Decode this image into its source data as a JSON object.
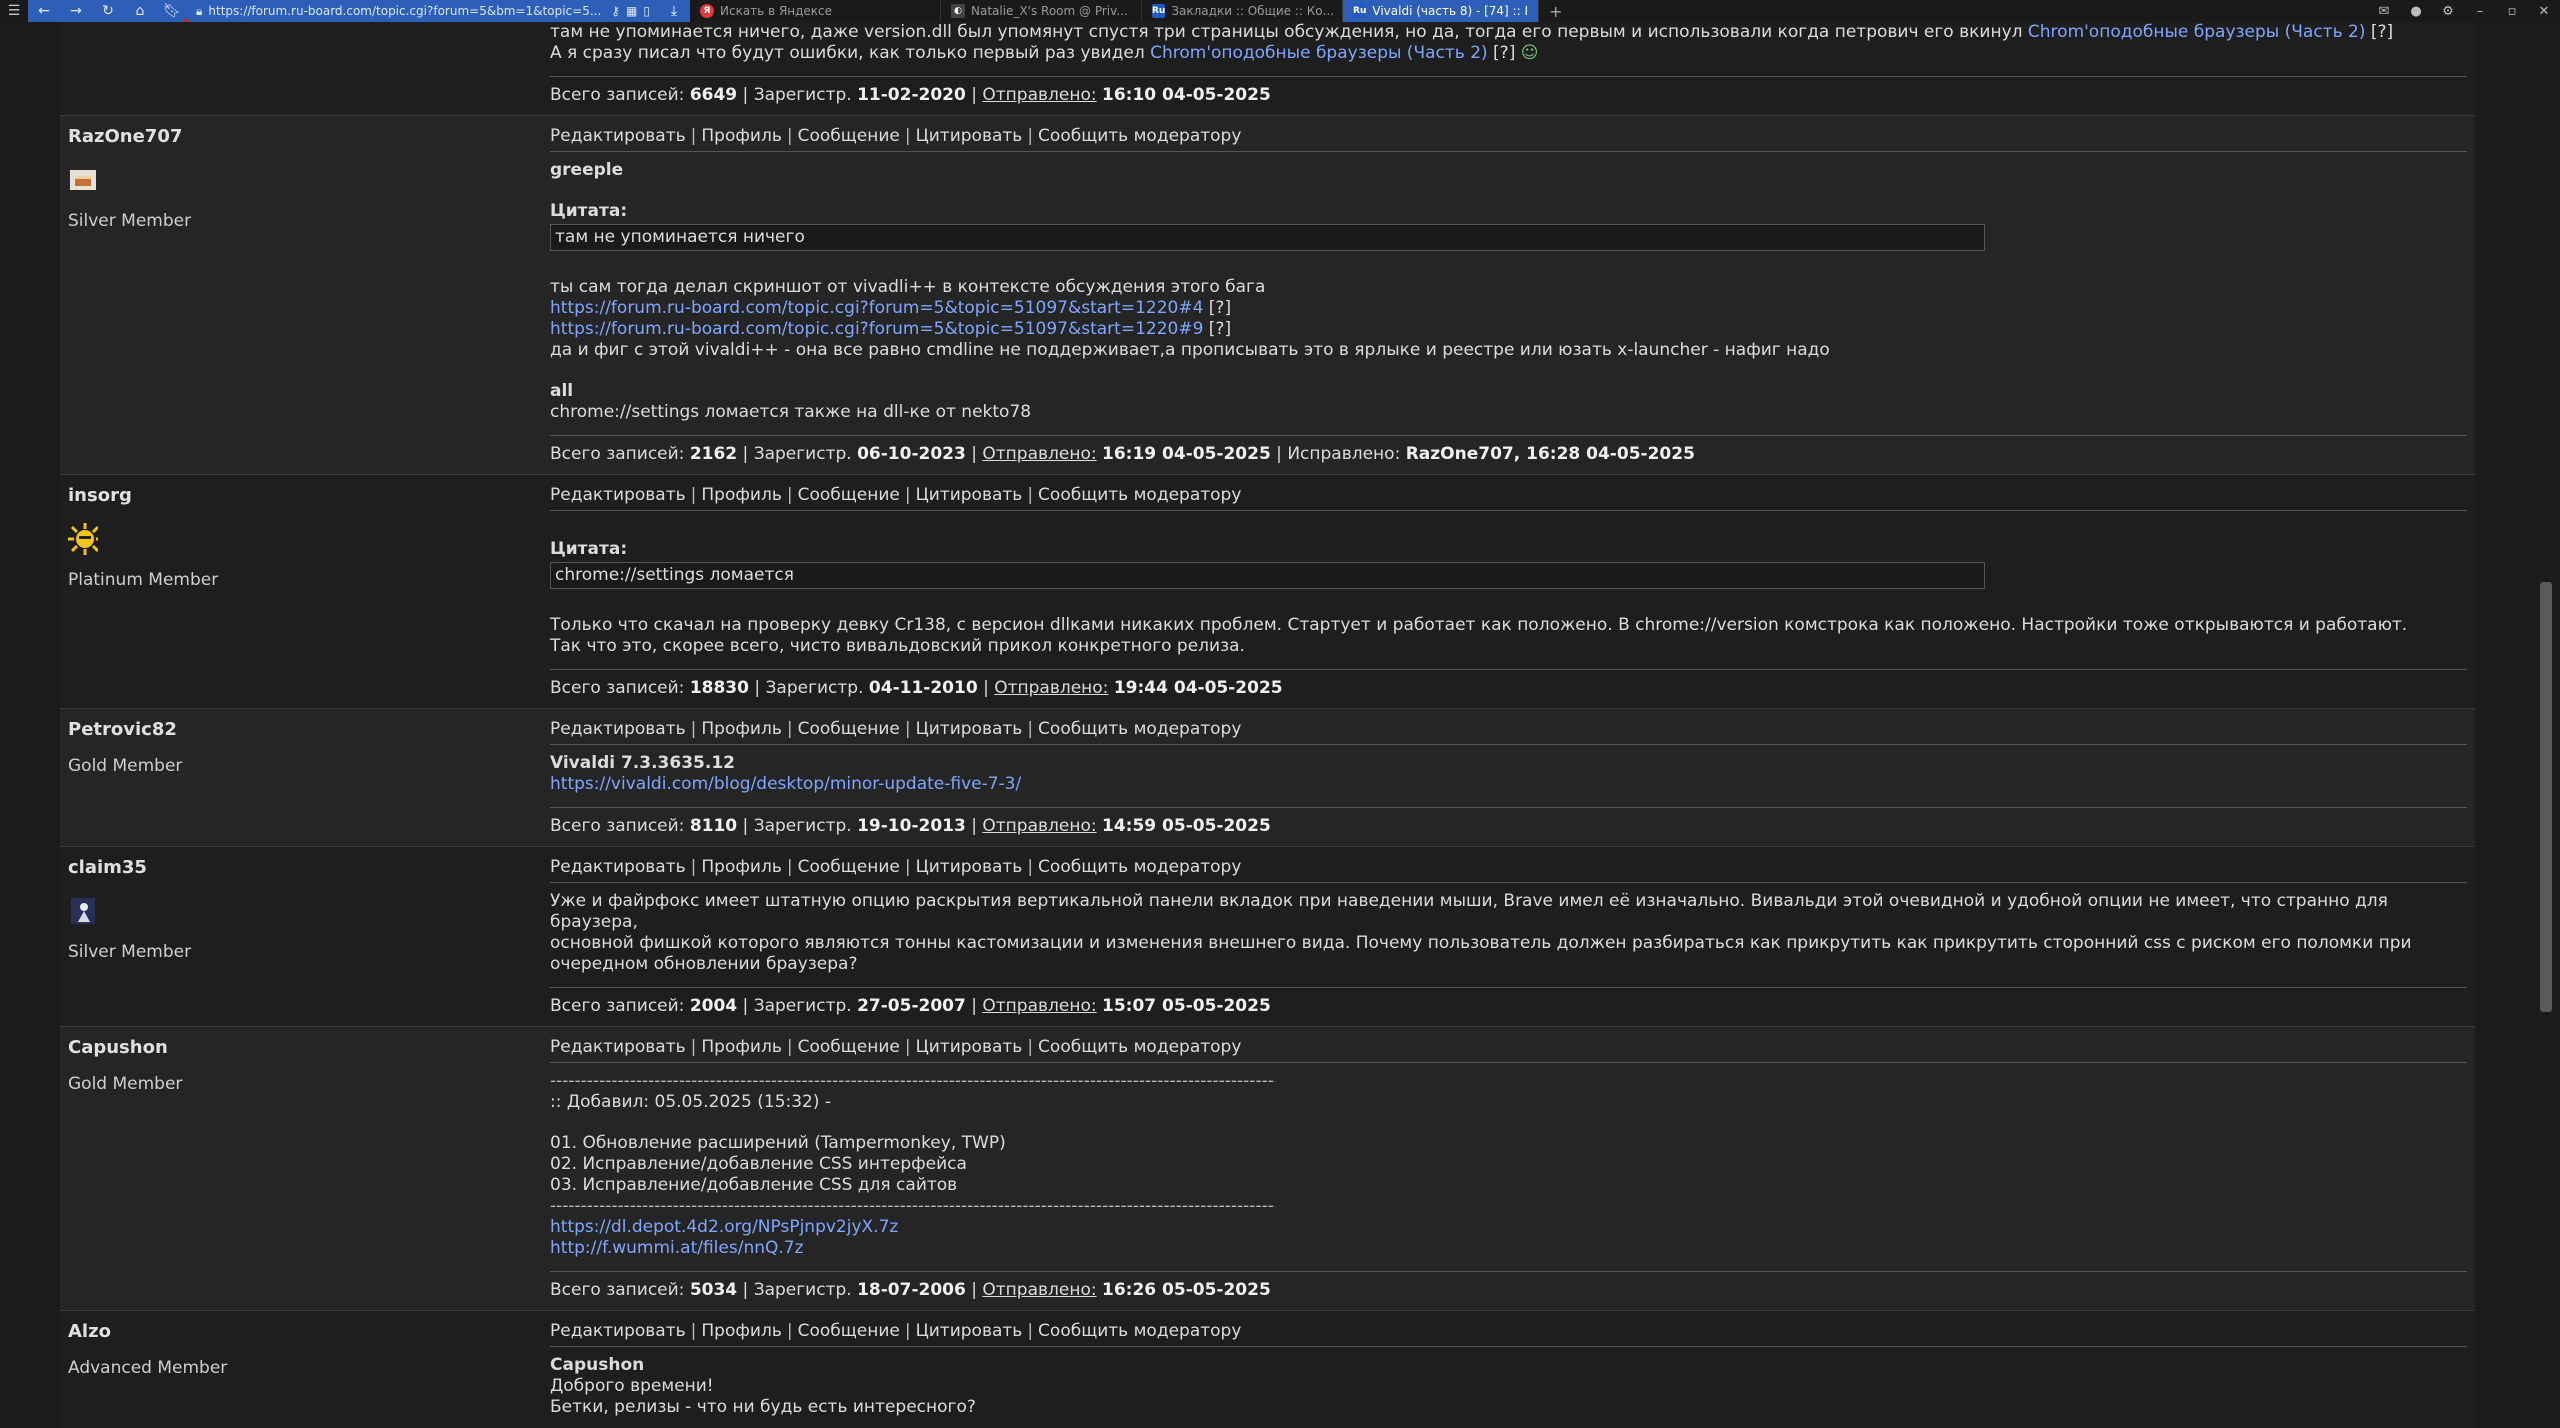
{
  "browser": {
    "address": "https://forum.ru-board.com/topic.cgi?forum=5&bm=1&topic=5...",
    "tabs": [
      {
        "title": "Искать в Яндексе",
        "icon": "yandex-icon",
        "color": "#e53935"
      },
      {
        "title": "Natalie_X's Room @ Priv...",
        "icon": "github-icon",
        "color": "#444444"
      },
      {
        "title": "Закладки :: Общие :: Ко...",
        "icon": "ru-board-icon",
        "color": "#1e5bc6"
      },
      {
        "title": "Vivaldi (часть 8) - [74] :: I",
        "icon": "ru-board-icon",
        "color": "#1e5bc6",
        "active": true
      }
    ]
  },
  "labels": {
    "edit": "Редактировать",
    "profile": "Профиль",
    "message": "Сообщение",
    "quote": "Цитировать",
    "report": "Сообщить модератору",
    "quote_title": "Цитата:",
    "total": "Всего записей:",
    "registered": "Зарегистр.",
    "sent": "Отправлено:",
    "fixed": "Исправлено:"
  },
  "top_fragment": {
    "line1": "там не упоминается ничего, даже version.dll был упомянут спустя три страницы обсуждения, но да, тогда его первым и использовали когда петрович его вкинул",
    "line1_link": "Chrom'оподобные браузеры (Часть 2)",
    "line1_tail": " [?]",
    "line2": "А я сразу писал что будут ошибки, как только первый раз увидел ",
    "line2_link": "Chrom'оподобные браузеры (Часть 2)",
    "line2_tail": " [?]",
    "footer": {
      "total": "6649",
      "reg": "11-02-2020",
      "sent": "16:10 04-05-2025"
    }
  },
  "posts": [
    {
      "nick": "RazOne707",
      "rank": "Silver Member",
      "avatar": "avatar-cake",
      "greeting": "greeple",
      "quote": "там не упоминается ничего",
      "text1": "ты сам тогда делал скриншот  от vivadli++ в контексте обсуждения этого бага",
      "link1": "https://forum.ru-board.com/topic.cgi?forum=5&topic=51097&start=1220#4",
      "link2": "https://forum.ru-board.com/topic.cgi?forum=5&topic=51097&start=1220#9",
      "qmark": " [?]",
      "text2": "да и фиг с этой vivaldi++ - она все равно cmdline не поддерживает,а прописывать это в ярлыке и реестре или юзать x-launcher - нафиг надо",
      "greeting2": "all",
      "text3": "chrome://settings ломается также на dll-ке от nekto78",
      "footer": {
        "total": "2162",
        "reg": "06-10-2023",
        "sent": "16:19 04-05-2025",
        "fixed": "RazOne707, 16:28 04-05-2025"
      }
    },
    {
      "nick": "insorg",
      "rank": "Platinum Member",
      "avatar": "avatar-sun",
      "quote": "chrome://settings ломается",
      "text1": "Только что скачал на проверку девку Cr138, с версион dllками никаких проблем. Стартует и работает как положено. В chrome://version комстрока как положено. Настройки тоже открываются и работают.",
      "text2": "Так что это, скорее всего, чисто вивальдовский прикол конкретного релиза.",
      "footer": {
        "total": "18830",
        "reg": "04-11-2010",
        "sent": "19:44 04-05-2025"
      }
    },
    {
      "nick": "Petrovic82",
      "rank": "Gold Member",
      "title": "Vivaldi 7.3.3635.12",
      "link": "https://vivaldi.com/blog/desktop/minor-update-five-7-3/",
      "footer": {
        "total": "8110",
        "reg": "19-10-2013",
        "sent": "14:59 05-05-2025"
      }
    },
    {
      "nick": "claim35",
      "rank": "Silver Member",
      "avatar": "avatar-figure",
      "text1": "Уже и файрфокс имеет штатную опцию раскрытия вертикальной панели вкладок при наведении мыши, Brave имел её изначально. Вивальди этой очевидной и удобной опции не имеет, что странно для браузера,",
      "text2": "основной фишкой которого являются тонны кастомизации и изменения внешнего вида. Почему пользователь должен разбираться как прикрутить как прикрутить сторонний css с риском его поломки при",
      "text3": "очередном обновлении браузера?",
      "footer": {
        "total": "2004",
        "reg": "27-05-2007",
        "sent": "15:07 05-05-2025"
      }
    },
    {
      "nick": "Capushon",
      "rank": "Gold Member",
      "dashes": "---------------------------------------------------------------------------------------------------------------------------------",
      "added": ":: Добавил: 05.05.2025 (15:32) -",
      "items": [
        "01. Обновление расширений (Tampermonkey, TWP)",
        "02. Исправление/добавление CSS интерфейса",
        "03. Исправление/добавление CSS для сайтов"
      ],
      "link1": "https://dl.depot.4d2.org/NPsPjnpv2jyX.7z",
      "link2": "http://f.wummi.at/files/nnQ.7z",
      "footer": {
        "total": "5034",
        "reg": "18-07-2006",
        "sent": "16:26 05-05-2025"
      }
    },
    {
      "nick": "Alzo",
      "rank": "Advanced Member",
      "greeting": "Capushon",
      "text1": "Доброго времени!",
      "text2": "Бетки, релизы - что ни будь есть интересного?"
    }
  ]
}
